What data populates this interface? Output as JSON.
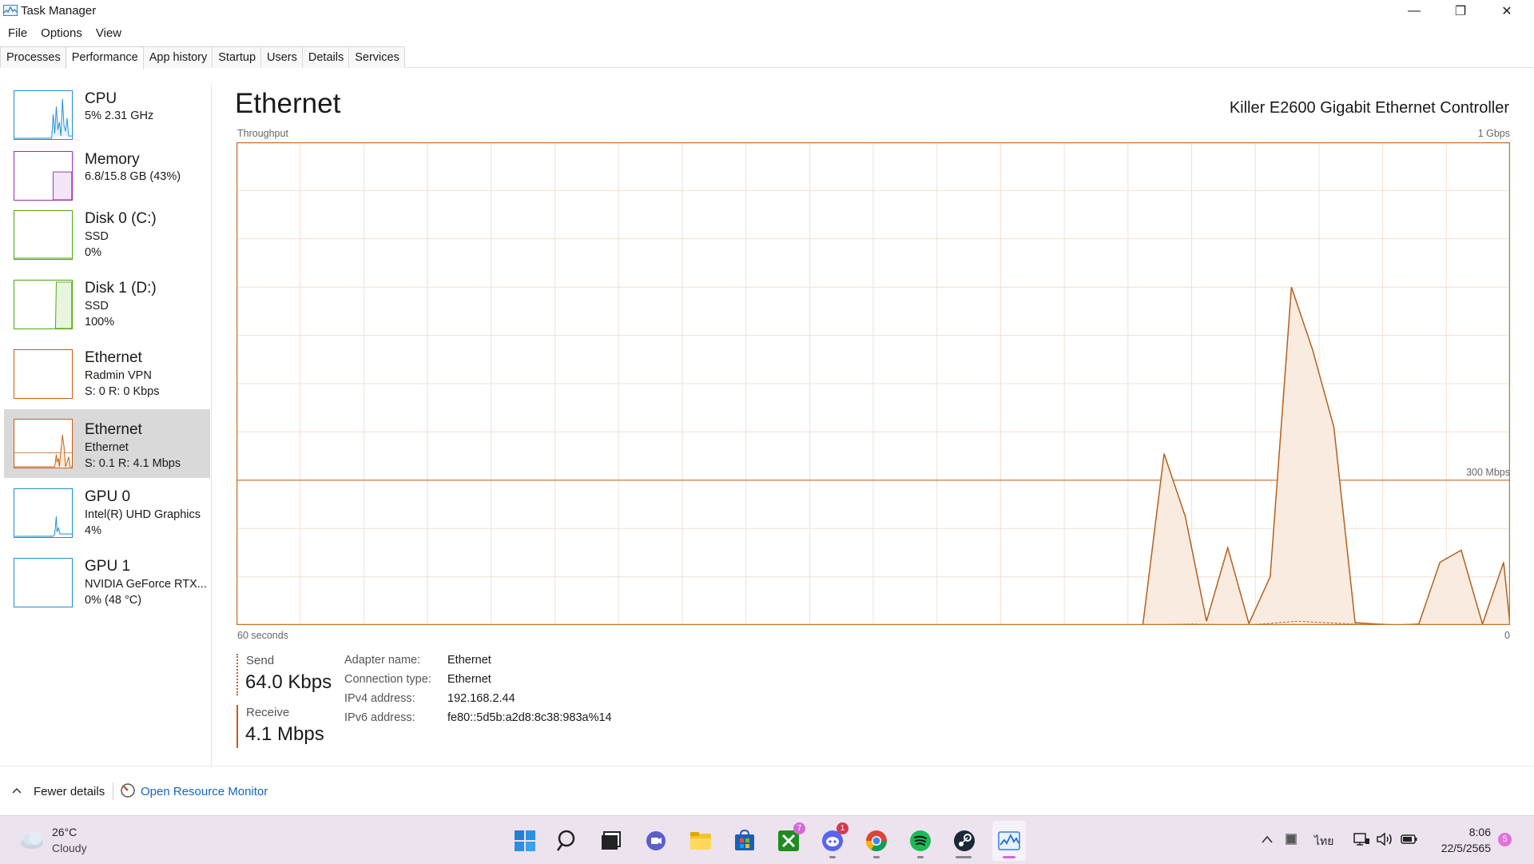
{
  "window": {
    "title": "Task Manager",
    "minimize": "—",
    "restore": "❐",
    "close": "✕"
  },
  "menu": [
    "File",
    "Options",
    "View"
  ],
  "tabs": [
    "Processes",
    "Performance",
    "App history",
    "Startup",
    "Users",
    "Details",
    "Services"
  ],
  "active_tab": "Performance",
  "sidebar": [
    {
      "title": "CPU",
      "line1": "5% 2.31 GHz",
      "line2": "",
      "color": "#1e8fd6"
    },
    {
      "title": "Memory",
      "line1": "6.8/15.8 GB (43%)",
      "line2": "",
      "color": "#9b32b4"
    },
    {
      "title": "Disk 0 (C:)",
      "line1": "SSD",
      "line2": "0%",
      "color": "#4da60c"
    },
    {
      "title": "Disk 1 (D:)",
      "line1": "SSD",
      "line2": "100%",
      "color": "#4da60c"
    },
    {
      "title": "Ethernet",
      "line1": "Radmin VPN",
      "line2": "S: 0 R: 0 Kbps",
      "color": "#c75f12"
    },
    {
      "title": "Ethernet",
      "line1": "Ethernet",
      "line2": "S: 0.1 R: 4.1 Mbps",
      "color": "#c75f12",
      "selected": true
    },
    {
      "title": "GPU 0",
      "line1": "Intel(R) UHD Graphics",
      "line2": "4%",
      "color": "#1e8fd6"
    },
    {
      "title": "GPU 1",
      "line1": "NVIDIA GeForce RTX...",
      "line2": "0% (48 °C)",
      "color": "#1e8fd6"
    }
  ],
  "main": {
    "title": "Ethernet",
    "device": "Killer E2600 Gigabit Ethernet Controller",
    "graph_label_top_left": "Throughput",
    "graph_label_top_right": "1 Gbps",
    "graph_label_mid": "300 Mbps",
    "graph_label_bottom_left": "60 seconds",
    "graph_label_bottom_right": "0"
  },
  "chart_data": {
    "type": "area",
    "title": "Throughput",
    "x_unit": "seconds ago",
    "xlim": [
      60,
      0
    ],
    "ylim_mbps": [
      0,
      1000
    ],
    "scale_line_mbps": 300,
    "series": [
      {
        "name": "Receive",
        "x": [
          60,
          17.3,
          16.3,
          15.3,
          14.3,
          13.3,
          12.3,
          11.3,
          10.3,
          9.3,
          8.3,
          7.3,
          6.3,
          5.3,
          4.3,
          3.3,
          2.3,
          1.3,
          0.3,
          0
        ],
        "values": [
          0,
          0,
          355,
          225,
          8,
          160,
          3,
          100,
          700,
          570,
          410,
          5,
          2,
          0,
          2,
          130,
          155,
          2,
          130,
          0
        ]
      },
      {
        "name": "Send",
        "x": [
          60,
          17.3,
          15,
          12.3,
          10,
          8.3,
          6.3,
          0
        ],
        "values": [
          0,
          0,
          2,
          0,
          8,
          4,
          0,
          0
        ]
      }
    ]
  },
  "stats": {
    "send_label": "Send",
    "send_value": "64.0 Kbps",
    "receive_label": "Receive",
    "receive_value": "4.1 Mbps"
  },
  "properties": [
    {
      "label": "Adapter name:",
      "value": "Ethernet"
    },
    {
      "label": "Connection type:",
      "value": "Ethernet"
    },
    {
      "label": "IPv4 address:",
      "value": "192.168.2.44"
    },
    {
      "label": "IPv6 address:",
      "value": "fe80::5d5b:a2d8:8c38:983a%14"
    }
  ],
  "footer": {
    "fewer_details": "Fewer details",
    "open_resource_monitor": "Open Resource Monitor"
  },
  "taskbar": {
    "weather_temp": "26°C",
    "weather_desc": "Cloudy",
    "xbox_badge": "7",
    "discord_badge": "1",
    "language": "ไทย",
    "time": "8:06",
    "date": "22/5/2565",
    "notification_count": "5",
    "icons": [
      "start-icon",
      "search-icon",
      "task-view-icon",
      "teams-chat-icon",
      "file-explorer-icon",
      "store-icon",
      "xbox-icon",
      "discord-icon",
      "chrome-icon",
      "spotify-icon",
      "steam-icon",
      "task-manager-icon"
    ]
  }
}
